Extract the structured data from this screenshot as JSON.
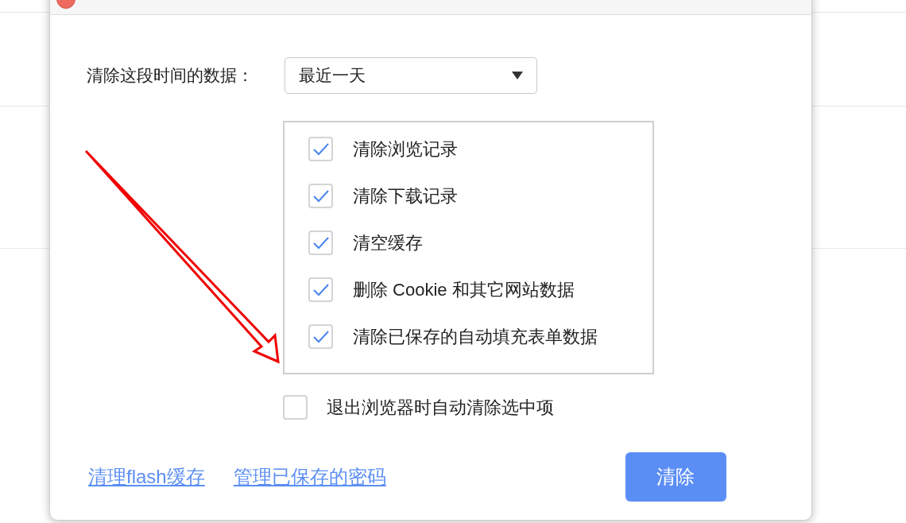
{
  "dialog": {
    "range_label": "清除这段时间的数据：",
    "range_value": "最近一天",
    "options": [
      {
        "label": "清除浏览记录",
        "checked": true
      },
      {
        "label": "清除下载记录",
        "checked": true
      },
      {
        "label": "清空缓存",
        "checked": true
      },
      {
        "label": "删除 Cookie 和其它网站数据",
        "checked": true
      },
      {
        "label": "清除已保存的自动填充表单数据",
        "checked": true
      }
    ],
    "auto_clear": {
      "label": "退出浏览器时自动清除选中项",
      "checked": false
    },
    "links": [
      "清理flash缓存",
      "管理已保存的密码"
    ],
    "button": "清除"
  }
}
